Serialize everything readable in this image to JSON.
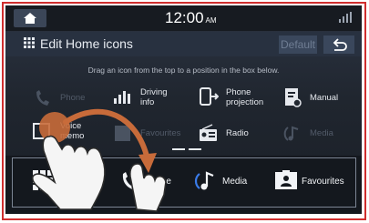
{
  "status_bar": {
    "time": "12:00",
    "ampm": "AM"
  },
  "header": {
    "title": "Edit Home icons",
    "default_label": "Default"
  },
  "instruction": "Drag an icon from the top to a position in the box below.",
  "available_icons": [
    {
      "label": "Phone",
      "icon": "phone-icon"
    },
    {
      "label": "Driving\ninfo",
      "icon": "driving-info-icon"
    },
    {
      "label": "Phone\nprojection",
      "icon": "phone-projection-icon"
    },
    {
      "label": "Manual",
      "icon": "manual-icon"
    },
    {
      "label": "Voice\nmemo",
      "icon": "voice-memo-icon"
    },
    {
      "label": "Favourites",
      "icon": "favourites-icon"
    },
    {
      "label": "Radio",
      "icon": "radio-icon"
    },
    {
      "label": "Media",
      "icon": "media-icon"
    }
  ],
  "home_tray": [
    {
      "label": "All menus",
      "icon": "all-menus-icon"
    },
    {
      "label": "Phone",
      "icon": "phone-icon"
    },
    {
      "label": "Media",
      "icon": "media-icon"
    },
    {
      "label": "Favourites",
      "icon": "favourites-icon"
    }
  ],
  "colors": {
    "screen": "#20262f",
    "accent": "#2f5dd8",
    "frame": "#cf2e2e",
    "drag_touch": "#c86b3a"
  }
}
